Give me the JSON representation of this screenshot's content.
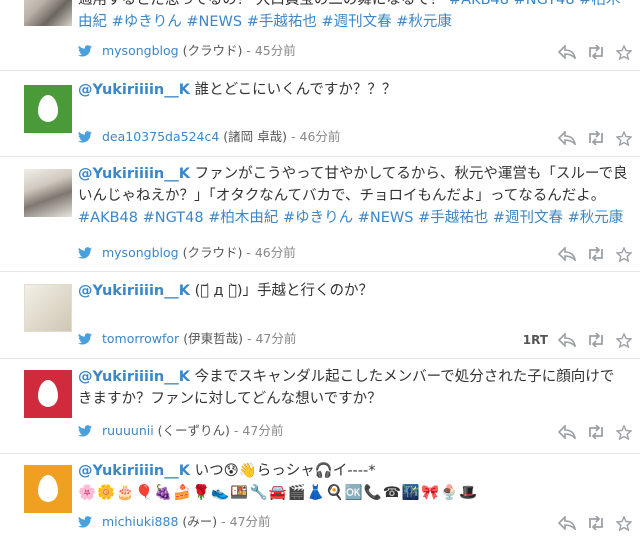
{
  "tweets": [
    {
      "text_partial": "適用するとだ思ってるの？ 大口員宝の二の舞になるで？",
      "tags": [
        "#AKB48",
        "#NGT48",
        "#柏木由紀",
        "#ゆきりん",
        "#NEWS",
        "#手越祐也",
        "#週刊文春",
        "#秋元康"
      ],
      "tag_first_row": [
        "#AKB48",
        "#NGT48",
        "#柏木"
      ],
      "tag_second_row_head": "由紀",
      "via": "mysongblog",
      "name": "(クラウド)",
      "time": "45分前"
    },
    {
      "user": "@Yukiriiiin__K",
      "text": "誰とどこにいくんですか？？？",
      "via": "dea10375da524c4",
      "name": "(諸岡 卓哉)",
      "time": "46分前",
      "avatar_color": "#4a9a3a"
    },
    {
      "user": "@Yukiriiiin__K",
      "text": "ファンがこうやって甘やかしてるから、秋元や運営も「スルーで良いんじゃねえか？」「オタクなんてバカで、チョロイもんだよ」ってなるんだよ。",
      "line1": "ファンがこうやって甘やかしてるから、秋元や運営も「スルーで良",
      "line2": "いんじゃねえか？」「オタクなんてバカで、チョロイもんだよ」ってなるんだよ。",
      "tags": [
        "#AKB48",
        "#NGT48",
        "#柏木由紀",
        "#ゆきりん",
        "#NEWS",
        "#手越祐也",
        "#週刊文春",
        "#秋元康"
      ],
      "via": "mysongblog",
      "name": "(クラウド)",
      "time": "46分前"
    },
    {
      "user": "@Yukiriiiin__K",
      "text": "(･᷄ д ･᷅)」手越と行くのか？",
      "via": "tomorrowfor",
      "name": "(伊東哲哉)",
      "time": "47分前",
      "rt": "1RT"
    },
    {
      "user": "@Yukiriiiin__K",
      "line1": "今までスキャンダル起こしたメンバーで処分された子に顔向けで",
      "line2": "きますか？ファンに対してどんな想いですか？",
      "via": "ruuuunii",
      "name": "(くーずりん)",
      "time": "47分前",
      "avatar_color": "#d02b3c"
    },
    {
      "user": "@Yukiriiiin__K",
      "line1": "いつ😰👋らっシャ🎧イ----*",
      "line2": "🌸🌼🎂🎈🍇🍰🌹👟🍱🔧🚘🎬👗🍳🆗📞☎🌃🎀🍨🎩",
      "via": "michiuki888",
      "name": "(みー)",
      "time": "47分前",
      "avatar_color": "#f0a020"
    }
  ],
  "colors": {
    "link": "#3b87c8",
    "icon": "#9aa0a6"
  }
}
